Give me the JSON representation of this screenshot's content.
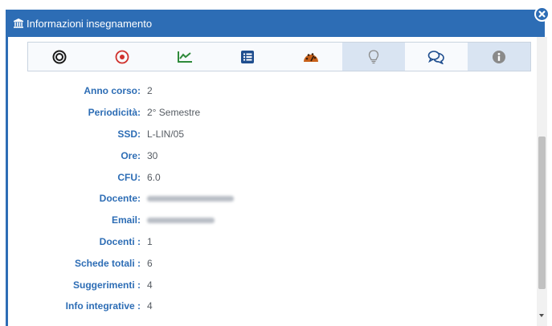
{
  "dialog": {
    "title": "Informazioni insegnamento",
    "title_icon": "bank-icon",
    "close_icon": "close-icon",
    "accent_color": "#2d6db5"
  },
  "toolbar": {
    "items": [
      {
        "icon": "target-icon",
        "color": "#1a1a1a",
        "active": false
      },
      {
        "icon": "record-icon",
        "color": "#d0312d",
        "active": false
      },
      {
        "icon": "line-chart-icon",
        "color": "#2f8a3b",
        "active": false
      },
      {
        "icon": "list-icon",
        "color": "#1f4e8f",
        "active": false
      },
      {
        "icon": "dashboard-icon",
        "color": "#c8601a",
        "active": false
      },
      {
        "icon": "lightbulb-icon",
        "color": "#8a8a8a",
        "active": true
      },
      {
        "icon": "comments-icon",
        "color": "#1f4e8f",
        "active": false
      },
      {
        "icon": "info-icon",
        "color": "#8a8a8a",
        "active": true
      }
    ]
  },
  "fields": [
    {
      "label": "Anno corso:",
      "value": "2"
    },
    {
      "label": "Periodicità:",
      "value": "2° Semestre"
    },
    {
      "label": "SSD:",
      "value": "L-LIN/05"
    },
    {
      "label": "Ore:",
      "value": "30"
    },
    {
      "label": "CFU:",
      "value": "6.0"
    },
    {
      "label": "Docente:",
      "value": "",
      "blurred": true
    },
    {
      "label": "Email:",
      "value": "",
      "blurred": true
    },
    {
      "label": "Docenti :",
      "value": "1"
    },
    {
      "label": "Schede totali :",
      "value": "6"
    },
    {
      "label": "Suggerimenti :",
      "value": "4"
    },
    {
      "label": "Info integrative :",
      "value": "4"
    }
  ]
}
